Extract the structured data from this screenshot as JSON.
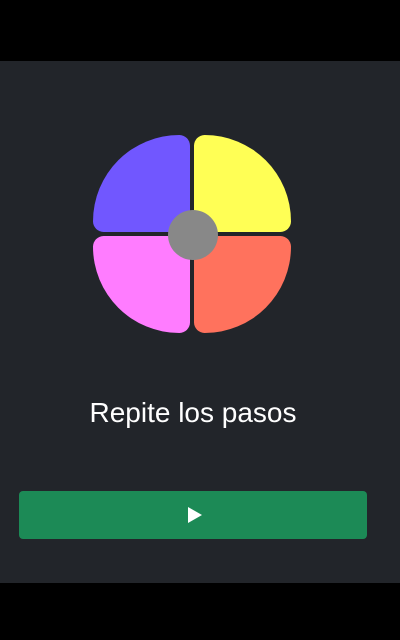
{
  "game": {
    "pads": [
      {
        "id": "purple",
        "color": "#7157ff"
      },
      {
        "id": "yellow",
        "color": "#ffff55"
      },
      {
        "id": "pink",
        "color": "#ff7cff"
      },
      {
        "id": "red",
        "color": "#ff725d"
      }
    ],
    "center_color": "#888888",
    "message": "Repite los pasos"
  },
  "controls": {
    "play_icon": "play-icon",
    "button_color": "#1c8a56"
  }
}
